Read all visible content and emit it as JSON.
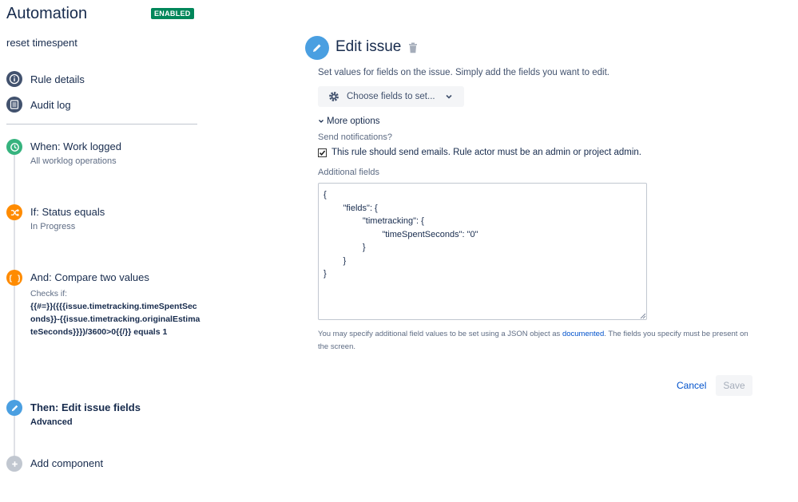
{
  "app": {
    "title": "Automation",
    "status_badge": "ENABLED",
    "rule_name": "reset timespent"
  },
  "nav": [
    {
      "label": "Rule details",
      "icon": "info-icon"
    },
    {
      "label": "Audit log",
      "icon": "list-icon"
    }
  ],
  "steps": {
    "trigger": {
      "title": "When: Work logged",
      "subtitle": "All worklog operations",
      "icon": "clock-icon",
      "color": "#36b37e"
    },
    "condition": {
      "title": "If: Status equals",
      "subtitle": "In Progress",
      "icon": "shuffle-icon",
      "color": "#ff8b00"
    },
    "compare": {
      "title": "And: Compare two values",
      "checks_label": "Checks if:",
      "expression": "{{#=}}({{{issue.timetracking.timeSpentSeconds}}-{{issue.timetracking.originalEstimateSeconds}}})/3600>0{{/}} equals 1",
      "icon": "braces-icon",
      "color": "#ff8b00"
    },
    "action": {
      "title": "Then: Edit issue fields",
      "subtitle": "Advanced",
      "icon": "pencil-icon",
      "color": "#4a9fe1"
    },
    "add": {
      "label": "Add component",
      "icon": "plus-icon",
      "color": "#c1c7d0"
    }
  },
  "panel": {
    "title": "Edit issue",
    "description": "Set values for fields on the issue. Simply add the fields you want to edit.",
    "choose_fields_label": "Choose fields to set...",
    "more_options_label": "More options",
    "send_notifications_label": "Send notifications?",
    "send_email_checkbox_label": "This rule should send emails. Rule actor must be an admin or project admin.",
    "send_email_checked": true,
    "additional_fields_label": "Additional fields",
    "additional_fields_value": "{\n        \"fields\": {\n                \"timetracking\": {\n                        \"timeSpentSeconds\": \"0\"\n                }\n        }\n}",
    "helper_prefix": "You may specify additional field values to be set using a JSON object as ",
    "helper_link": "documented",
    "helper_suffix": ". The fields you specify must be present on the screen.",
    "cancel_label": "Cancel",
    "save_label": "Save"
  },
  "colors": {
    "enabled_badge": "#00875a",
    "link": "#0052cc",
    "nav_icon": "#42526e"
  }
}
